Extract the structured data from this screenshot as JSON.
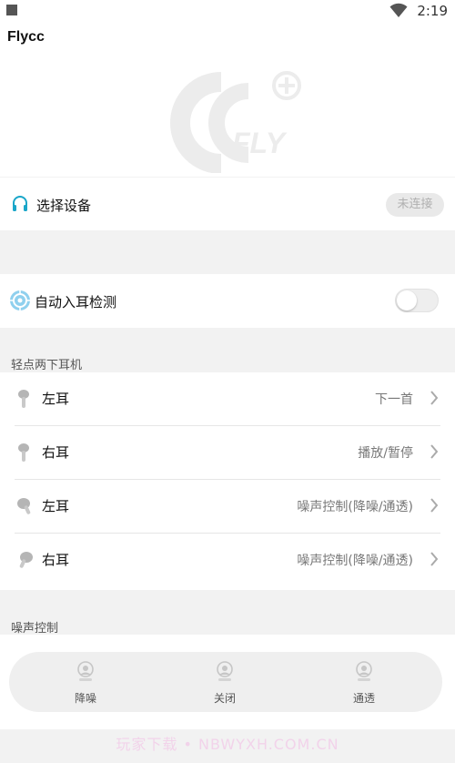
{
  "status_bar": {
    "time": "2:19"
  },
  "app": {
    "title": "Flycc"
  },
  "device": {
    "label": "选择设备",
    "status": "未连接"
  },
  "auto_detect": {
    "label": "自动入耳检测",
    "enabled": false
  },
  "tap_section": {
    "title": "轻点两下耳机",
    "rows": [
      {
        "label": "左耳",
        "value": "下一首"
      },
      {
        "label": "右耳",
        "value": "播放/暂停"
      },
      {
        "label": "左耳",
        "value": "噪声控制(降噪/通透)"
      },
      {
        "label": "右耳",
        "value": "噪声控制(降噪/通透)"
      }
    ]
  },
  "noise_section": {
    "title": "噪声控制",
    "options": [
      {
        "label": "降噪"
      },
      {
        "label": "关闭"
      },
      {
        "label": "通透"
      }
    ]
  },
  "watermark": {
    "text": "玩家下载 • NBWYXH.COM.CN"
  },
  "colors": {
    "accent": "#1aa6c9",
    "badge_bg": "#e9e9e9",
    "panel_bg": "#efefef"
  }
}
